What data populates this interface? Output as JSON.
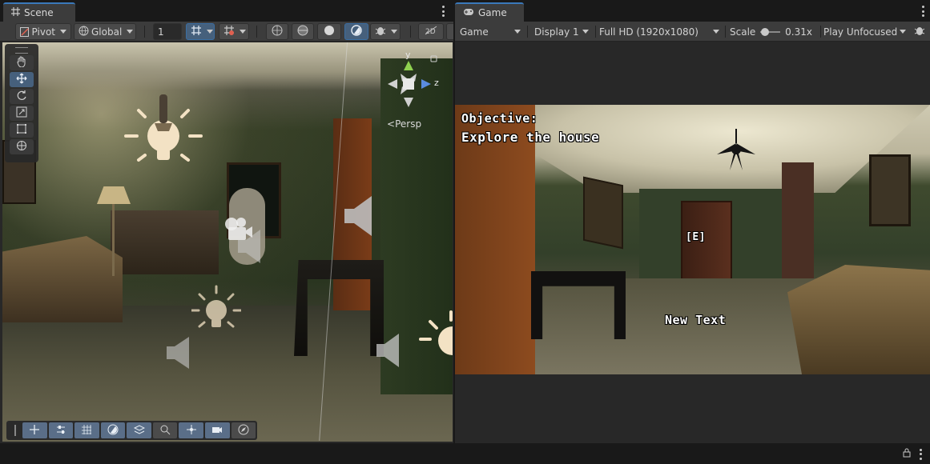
{
  "scene": {
    "tab_label": "Scene",
    "toolbar": {
      "pivot_label": "Pivot",
      "global_label": "Global",
      "grid_snap_value": "1"
    },
    "persp_label": "Persp",
    "axes": {
      "y": "y",
      "z": "z"
    },
    "tools": [
      "hand-tool",
      "move-tool",
      "rotate-tool",
      "scale-tool",
      "rect-tool",
      "transform-tool"
    ],
    "active_tool": "move-tool"
  },
  "game": {
    "tab_label": "Game",
    "toolbar": {
      "view_select": "Game",
      "display_select": "Display 1",
      "resolution_select": "Full HD (1920x1080)",
      "scale_label": "Scale",
      "scale_value": "0.31x",
      "scale_fraction": 0.05,
      "play_mode_select": "Play Unfocused"
    },
    "hud": {
      "objective_title": "Objective:",
      "objective_text": "Explore the house",
      "interact_prompt": "[E]",
      "new_text": "New Text"
    }
  },
  "colors": {
    "accent": "#3a79bb",
    "active_button": "#46607c",
    "panel": "#282828",
    "toolbar": "#3c3c3c"
  }
}
